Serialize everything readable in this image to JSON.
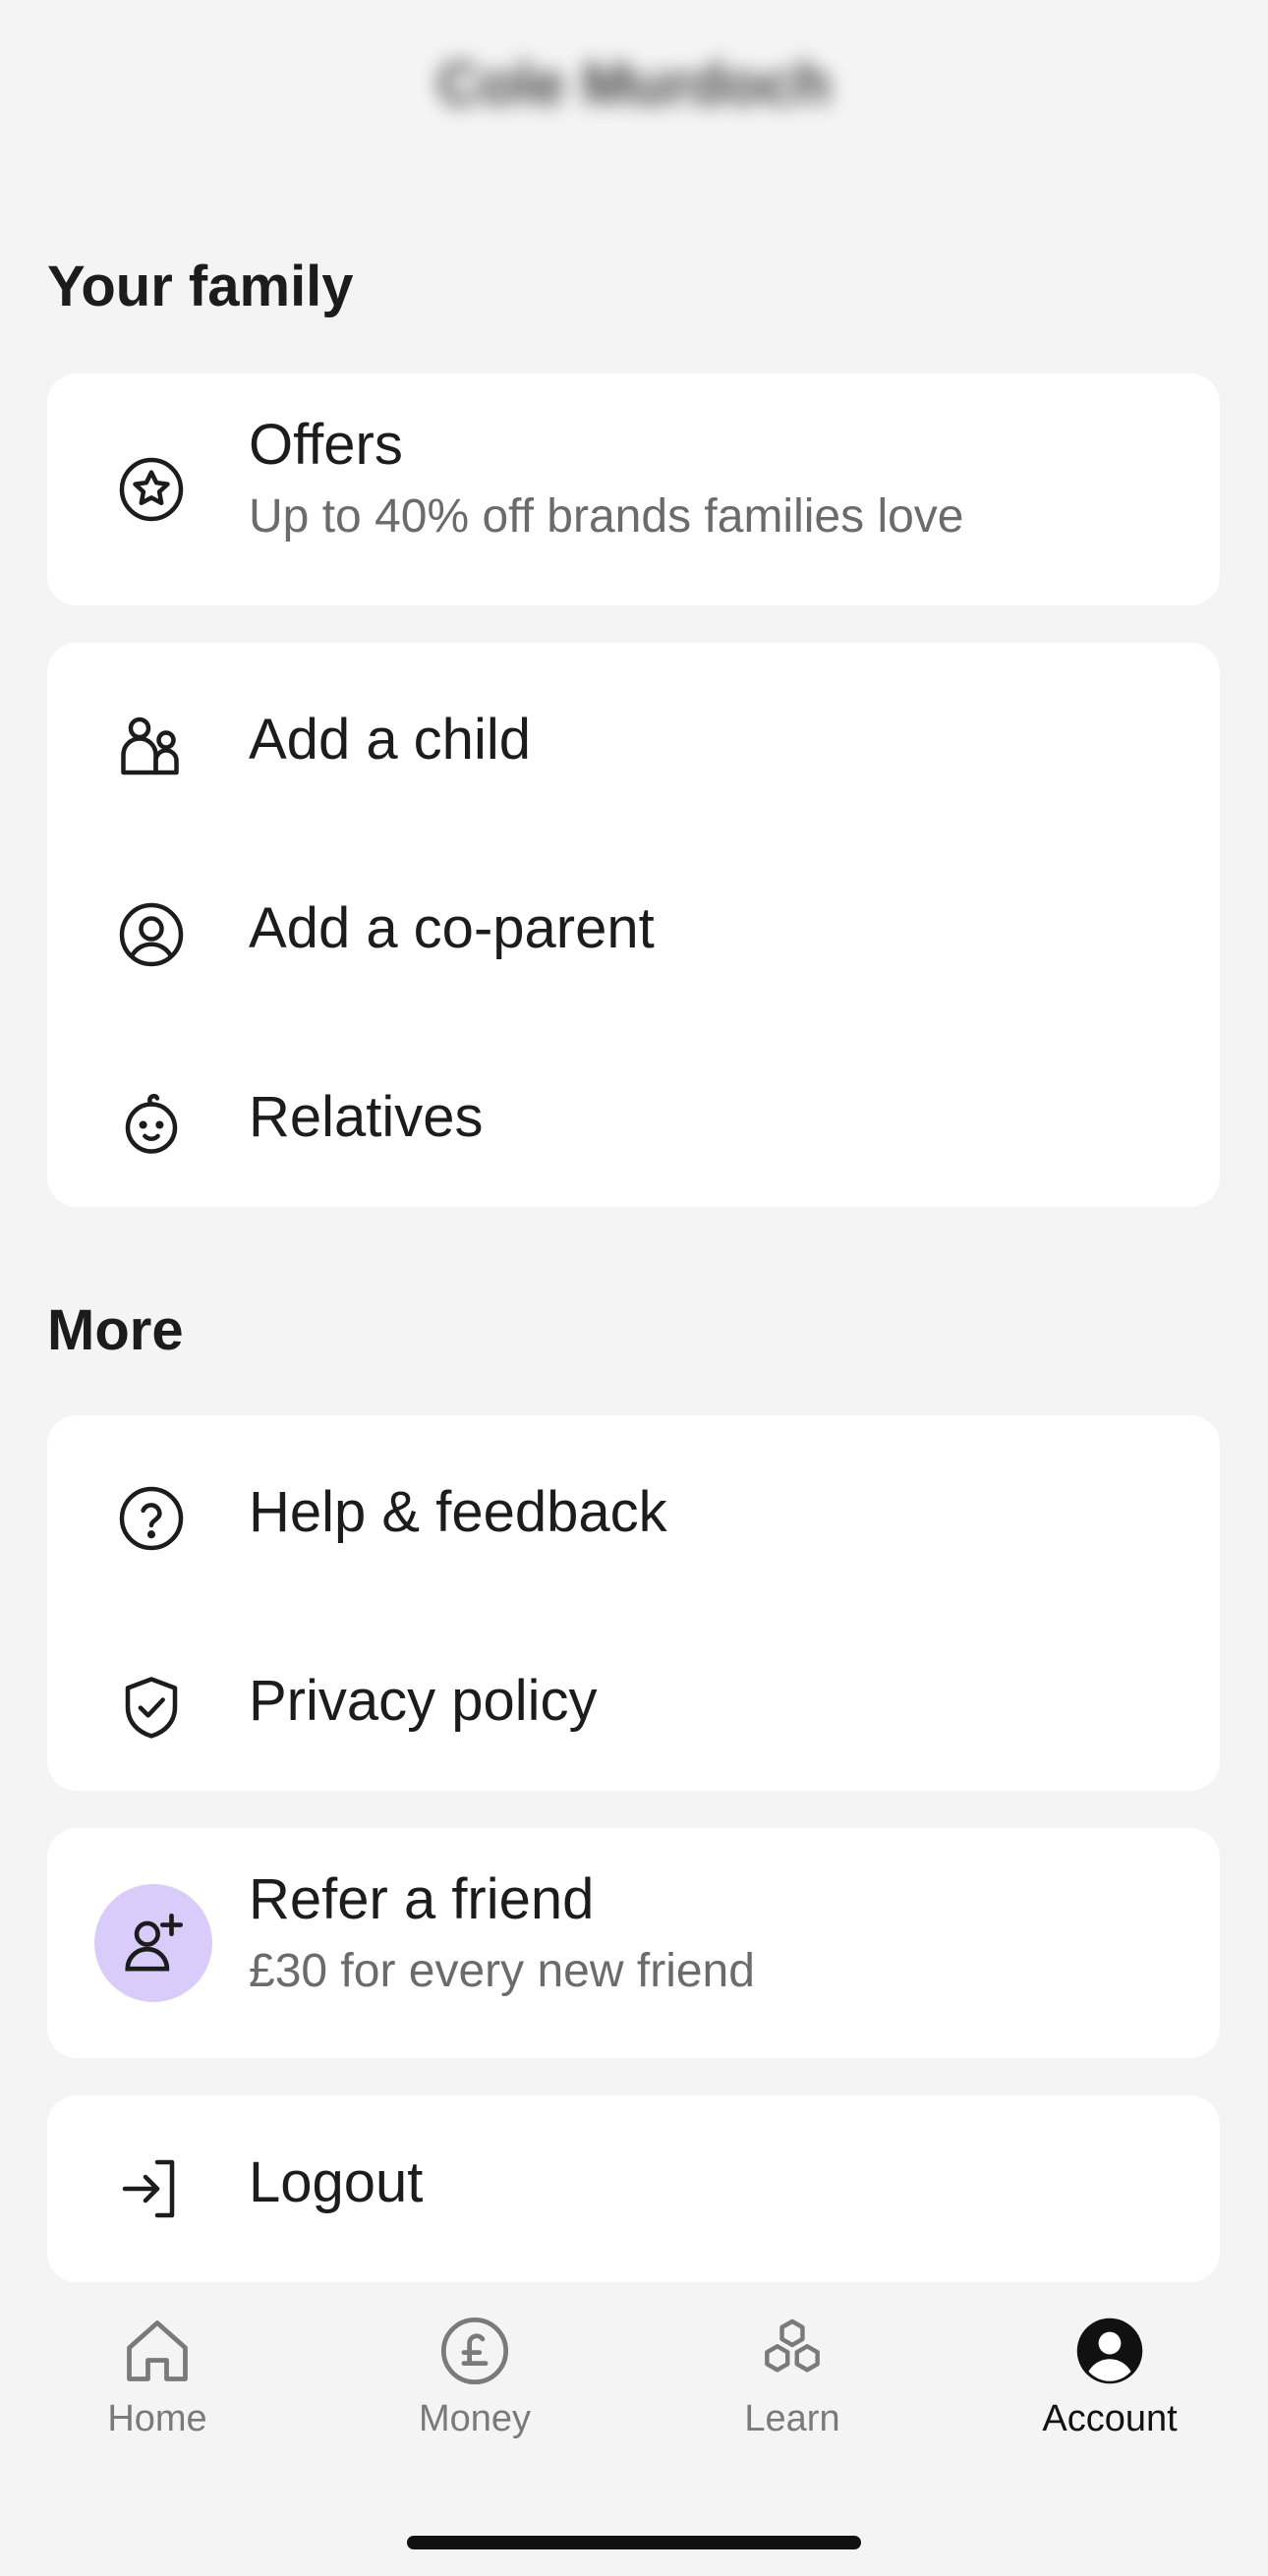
{
  "header": {
    "user_name": "Cole Murdoch"
  },
  "family_section": {
    "title": "Your family",
    "offers": {
      "label": "Offers",
      "subtitle": "Up to 40% off brands families love",
      "icon": "star-badge-icon"
    },
    "items": [
      {
        "label": "Add a child",
        "icon": "family-icon"
      },
      {
        "label": "Add a co-parent",
        "icon": "user-circle-icon"
      },
      {
        "label": "Relatives",
        "icon": "baby-face-icon"
      }
    ]
  },
  "more_section": {
    "title": "More",
    "items": [
      {
        "label": "Help & feedback",
        "icon": "question-circle-icon"
      },
      {
        "label": "Privacy policy",
        "icon": "shield-check-icon"
      }
    ],
    "refer": {
      "label": "Refer a friend",
      "subtitle": "£30 for every new friend",
      "icon": "add-user-icon",
      "accent": "#d9ccfb"
    },
    "logout": {
      "label": "Logout",
      "icon": "logout-icon"
    }
  },
  "tabbar": {
    "tabs": [
      {
        "label": "Home",
        "icon": "house-icon",
        "active": false
      },
      {
        "label": "Money",
        "icon": "pound-circle-icon",
        "active": false
      },
      {
        "label": "Learn",
        "icon": "hexagons-icon",
        "active": false
      },
      {
        "label": "Account",
        "icon": "account-icon",
        "active": true
      }
    ]
  },
  "colors": {
    "background": "#f4f4f4",
    "card": "#ffffff",
    "text": "#1c1c1c",
    "muted": "#6b6b6b",
    "accent": "#d9ccfb"
  }
}
